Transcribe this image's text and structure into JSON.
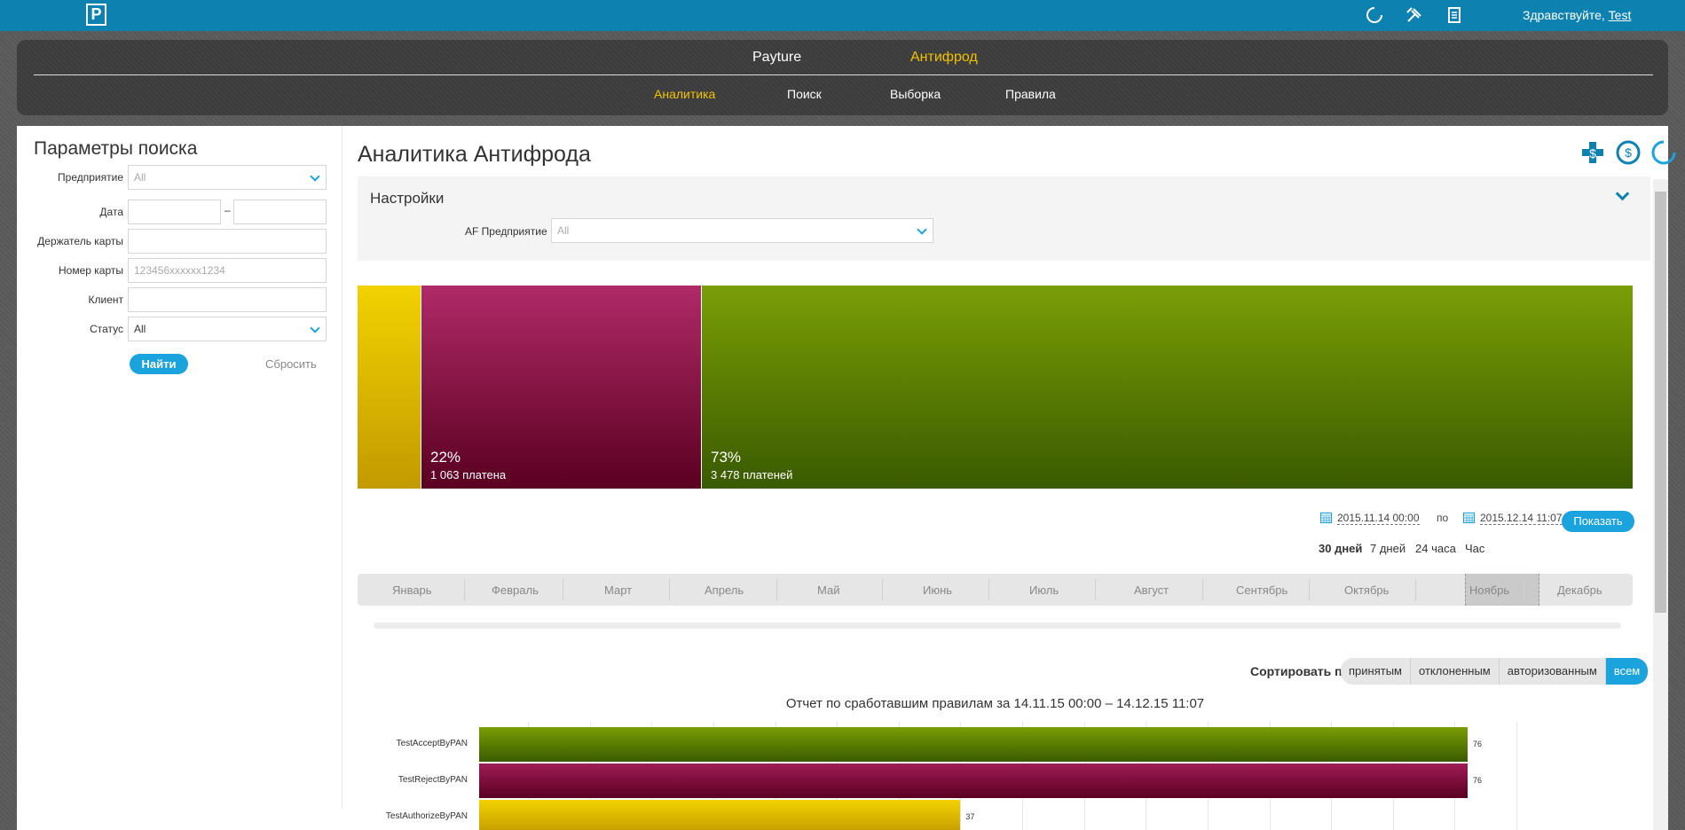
{
  "topbar": {
    "logo": "P",
    "greeting": "Здравствуйте,",
    "user": "Test"
  },
  "nav": {
    "top": [
      "Payture",
      "Антифрод"
    ],
    "sub": [
      "Аналитика",
      "Поиск",
      "Выборка",
      "Правила"
    ]
  },
  "search": {
    "title": "Параметры поиска",
    "fields": {
      "enterprise": {
        "label": "Предприятие",
        "value": "All"
      },
      "date": {
        "label": "Дата",
        "separator": "–"
      },
      "cardholder": {
        "label": "Держатель карты"
      },
      "card_number": {
        "label": "Номер карты",
        "placeholder": "123456xxxxxx1234"
      },
      "client": {
        "label": "Клиент"
      },
      "status": {
        "label": "Статус",
        "value": "All"
      }
    },
    "find": "Найти",
    "reset": "Сбросить"
  },
  "analytics": {
    "title": "Аналитика Антифрода",
    "settings": {
      "title": "Настройки",
      "af_label": "AF Предприятие",
      "af_value": "All"
    },
    "treemap": [
      {
        "pct": "",
        "count": "",
        "share": 0.05,
        "color": "yellow"
      },
      {
        "pct": "22%",
        "count": "1 063 платена",
        "share": 0.22,
        "color": "magenta"
      },
      {
        "pct": "73%",
        "count": "3 478 платеней",
        "share": 0.73,
        "color": "green"
      }
    ],
    "date_from": "2015.11.14 00:00",
    "date_to_label": "по",
    "date_to": "2015.12.14 11:07",
    "show": "Показать",
    "periods": [
      "30 дней",
      "7 дней",
      "24 часа",
      "Час"
    ],
    "months": [
      "Январь",
      "Февраль",
      "Март",
      "Апрель",
      "Май",
      "Июнь",
      "Июль",
      "Август",
      "Сентябрь",
      "Октябрь",
      "Ноябрь",
      "Декабрь"
    ],
    "sort_label": "Сортировать по",
    "sort_options": [
      "принятым",
      "отклоненным",
      "авторизованным",
      "всем"
    ],
    "report_title": "Отчет по сработавшим правилам за 14.11.15 00:00 – 14.12.15 11:07"
  },
  "chart_data": {
    "type": "bar",
    "categories": [
      "TestAcceptByPAN",
      "TestRejectByPAN",
      "TestAuthorizeByPAN"
    ],
    "values": [
      76,
      76,
      37
    ],
    "xlim": [
      0,
      76
    ]
  },
  "colors": {
    "topbar": "#0d82b0",
    "accent": "#1aa3dc",
    "active_nav": "#f2c200",
    "green": "#5f8a06",
    "magenta": "#8a1a48",
    "yellow": "#e9be00"
  }
}
